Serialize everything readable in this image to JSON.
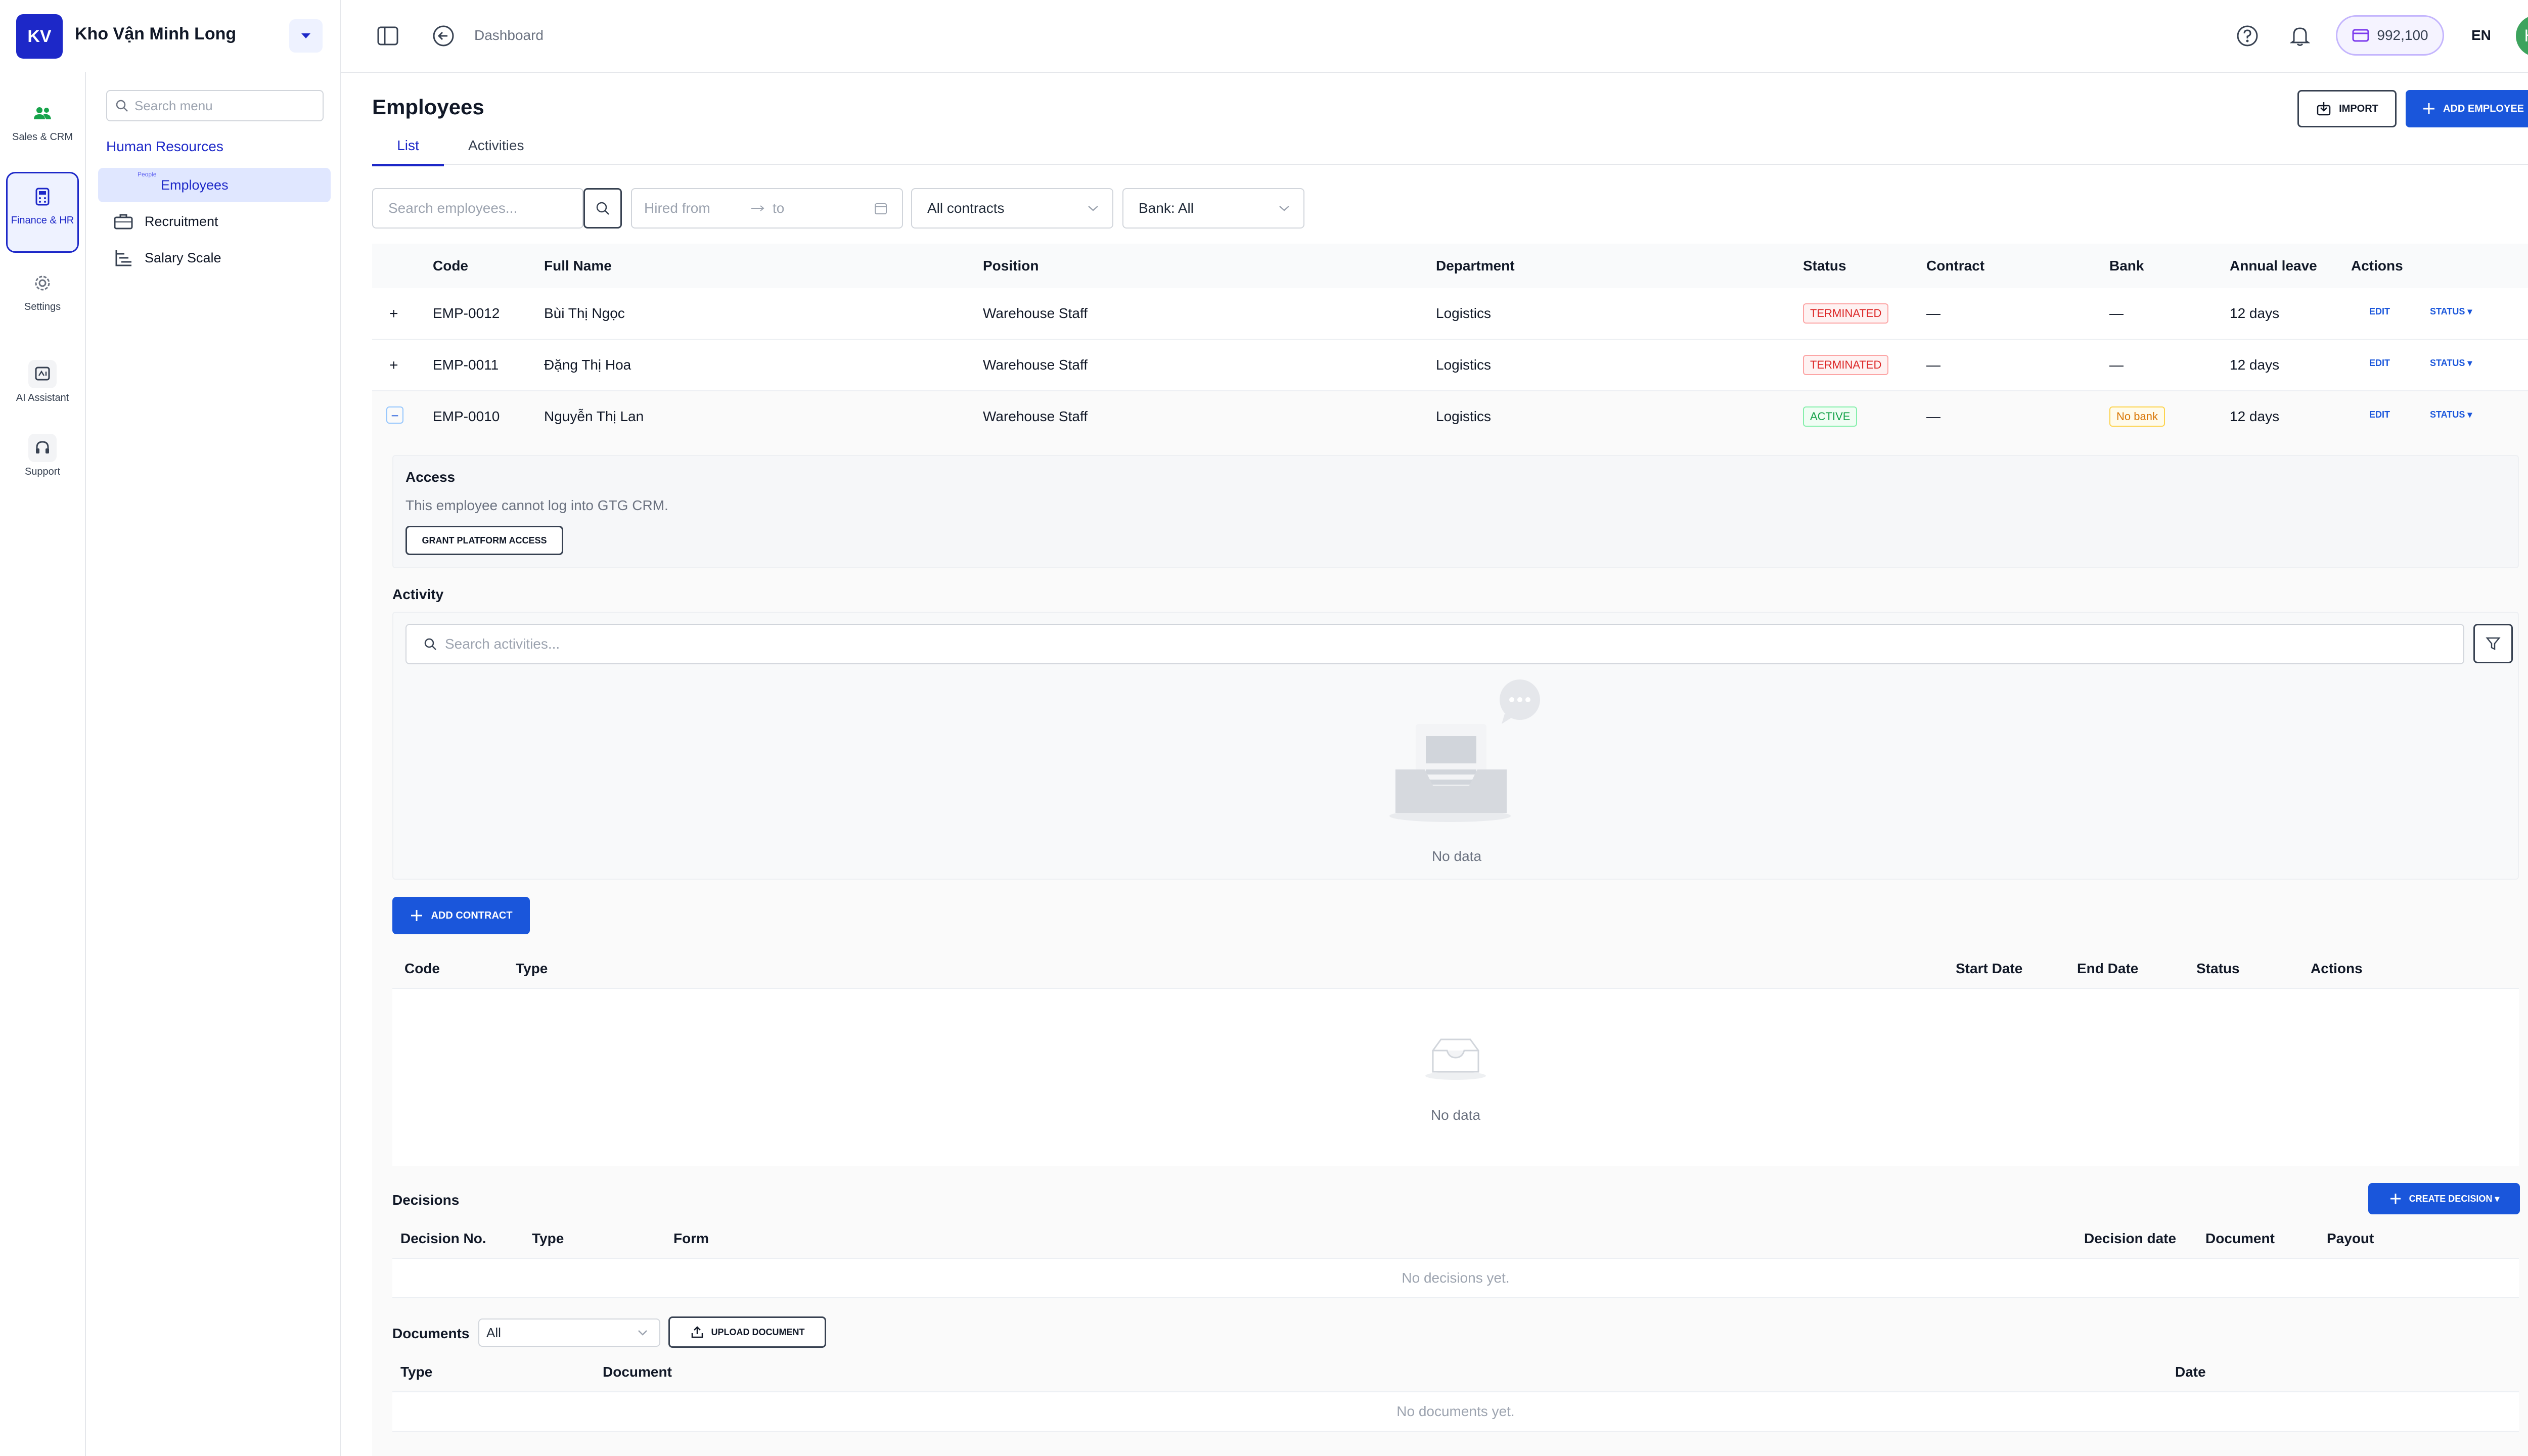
{
  "header": {
    "logo": "KV",
    "company": "Kho Vận Minh Long",
    "breadcrumb": "Dashboard",
    "credits": "992,100",
    "language": "EN",
    "user_initials": "HH"
  },
  "rail": {
    "items": [
      {
        "label": "Sales & CRM",
        "icon": "users-icon"
      },
      {
        "label": "Finance & HR",
        "icon": "calculator-icon",
        "active": true
      },
      {
        "label": "Settings",
        "icon": "gear-icon"
      },
      {
        "label": "AI Assistant",
        "icon": "ai-icon"
      },
      {
        "label": "Support",
        "icon": "headset-icon"
      }
    ]
  },
  "submenu": {
    "search_placeholder": "Search menu",
    "group": "Human Resources",
    "items": [
      {
        "label": "Employees",
        "tag": "People",
        "active": true
      },
      {
        "label": "Recruitment"
      },
      {
        "label": "Salary Scale"
      }
    ]
  },
  "page": {
    "title": "Employees",
    "import_label": "IMPORT",
    "add_label": "ADD EMPLOYEE",
    "tabs": [
      "List",
      "Activities"
    ]
  },
  "filters": {
    "search_placeholder": "Search employees...",
    "hired_from": "Hired from",
    "hired_to": "to",
    "contracts": "All contracts",
    "bank": "Bank: All"
  },
  "table": {
    "columns": [
      "Code",
      "Full Name",
      "Position",
      "Department",
      "Status",
      "Contract",
      "Bank",
      "Annual leave",
      "Actions"
    ],
    "rows": [
      {
        "expander": "+",
        "code": "EMP-0012",
        "name": "Bùi Thị Ngọc",
        "position": "Warehouse Staff",
        "department": "Logistics",
        "status": "TERMINATED",
        "contract": "—",
        "bank": "—",
        "leave": "12 days",
        "edit": "EDIT",
        "status_action": "STATUS ▾"
      },
      {
        "expander": "+",
        "code": "EMP-0011",
        "name": "Đặng Thị Hoa",
        "position": "Warehouse Staff",
        "department": "Logistics",
        "status": "TERMINATED",
        "contract": "—",
        "bank": "—",
        "leave": "12 days",
        "edit": "EDIT",
        "status_action": "STATUS ▾"
      },
      {
        "expander": "−",
        "code": "EMP-0010",
        "name": "Nguyễn Thị Lan",
        "position": "Warehouse Staff",
        "department": "Logistics",
        "status": "ACTIVE",
        "contract": "—",
        "bank": "No bank",
        "leave": "12 days",
        "edit": "EDIT",
        "status_action": "STATUS ▾"
      }
    ]
  },
  "detail": {
    "access_title": "Access",
    "access_text": "This employee cannot log into GTG CRM.",
    "grant_label": "GRANT PLATFORM ACCESS",
    "activity_title": "Activity",
    "activity_search_placeholder": "Search activities...",
    "no_data": "No data",
    "add_contract_label": "ADD CONTRACT",
    "contract_columns": [
      "Code",
      "Type",
      "Start Date",
      "End Date",
      "Status",
      "Actions"
    ],
    "contracts_empty": "No data",
    "decisions_title": "Decisions",
    "create_decision_label": "CREATE DECISION ▾",
    "decision_columns": [
      "Decision No.",
      "Type",
      "Form",
      "Decision date",
      "Document",
      "Payout"
    ],
    "decisions_empty": "No decisions yet.",
    "documents_title": "Documents",
    "documents_filter": "All",
    "upload_label": "UPLOAD DOCUMENT",
    "document_columns": [
      "Type",
      "Document",
      "Date"
    ],
    "documents_empty": "No documents yet."
  },
  "colors": {
    "brand": "#1d28c8",
    "primary": "#1a56db",
    "danger": "#dc2626",
    "success": "#16a34a",
    "warning": "#d97706"
  }
}
